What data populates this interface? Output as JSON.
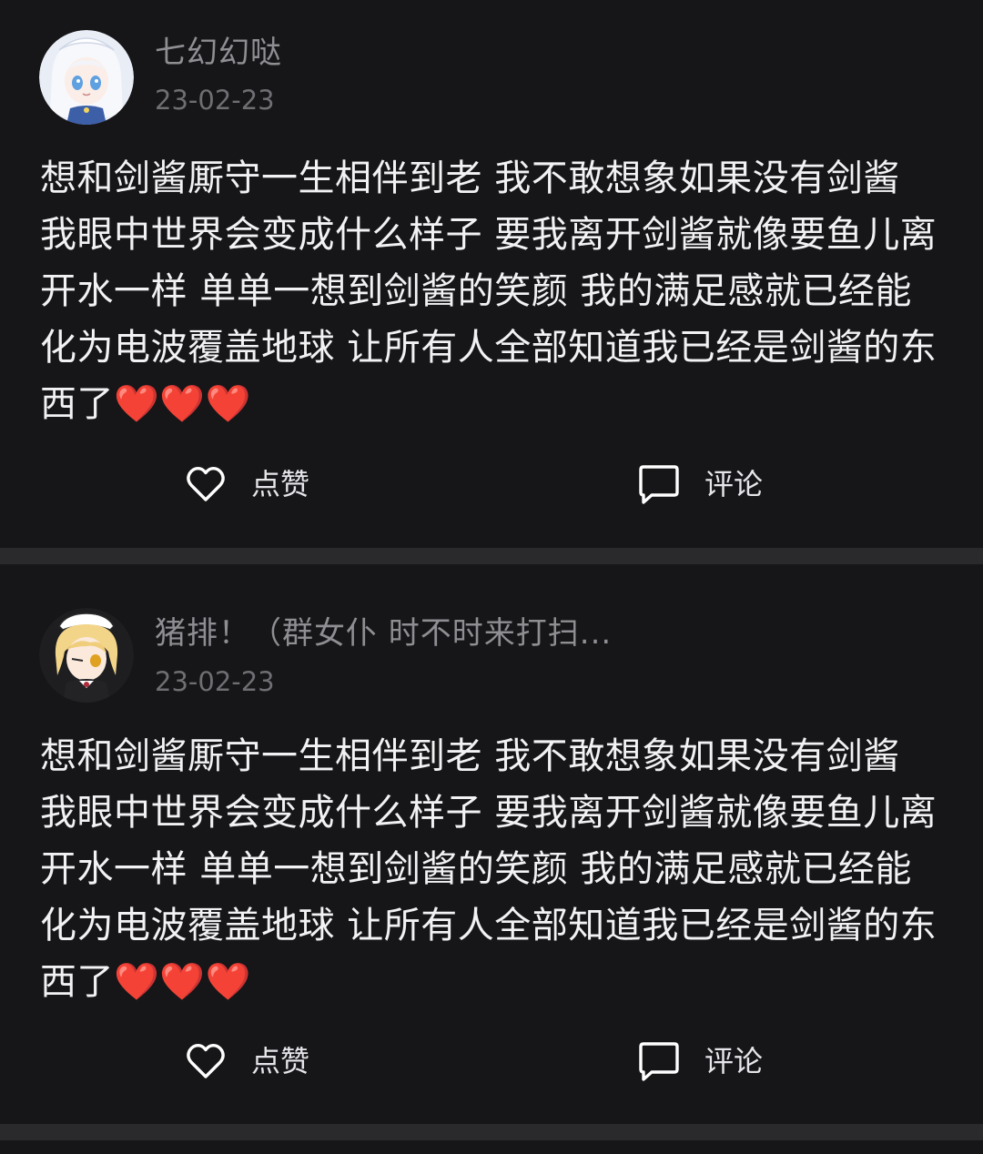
{
  "posts": [
    {
      "username": "七幻幻哒",
      "date": "23-02-23",
      "avatar": "white-haired-anime-girl-avatar",
      "text": "想和剑酱厮守一生相伴到老 我不敢想象如果没有剑酱 我眼中世界会变成什么样子 要我离开剑酱就像要鱼儿离开水一样 单单一想到剑酱的笑颜 我的满足感就已经能化为电波覆盖地球 让所有人全部知道我已经是剑酱的东西了❤️❤️❤️",
      "like_label": "点赞",
      "comment_label": "评论"
    },
    {
      "username": "猪排！（群女仆 时不时来打扫...",
      "date": "23-02-23",
      "avatar": "blonde-maid-anime-avatar",
      "text": "想和剑酱厮守一生相伴到老 我不敢想象如果没有剑酱 我眼中世界会变成什么样子 要我离开剑酱就像要鱼儿离开水一样 单单一想到剑酱的笑颜 我的满足感就已经能化为电波覆盖地球 让所有人全部知道我已经是剑酱的东西了❤️❤️❤️",
      "like_label": "点赞",
      "comment_label": "评论"
    }
  ],
  "colors": {
    "background": "#161618",
    "divider": "#2a2a2c",
    "username": "#8e8e93",
    "date": "#6e6e73",
    "text": "#f2f2f4"
  }
}
